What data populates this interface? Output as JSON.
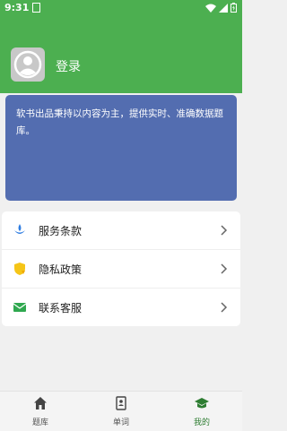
{
  "status_bar": {
    "time": "9:31",
    "sim_icon": "sim-card-icon",
    "wifi_icon": "wifi-icon",
    "signal_icon": "signal-icon",
    "battery_icon": "battery-charging-icon"
  },
  "header": {
    "login_label": "登录",
    "avatar_icon": "user-avatar-icon",
    "bg_color": "#4caf50"
  },
  "intro": {
    "text": "软书出品秉持以内容为主，提供实时、准确数据题库。",
    "bg_color": "#536db0"
  },
  "menu": {
    "items": [
      {
        "label": "服务条款",
        "icon": "drop-icon"
      },
      {
        "label": "隐私政策",
        "icon": "shield-icon"
      },
      {
        "label": "联系客服",
        "icon": "mail-icon"
      }
    ]
  },
  "tabs": [
    {
      "label": "题库",
      "icon": "home-icon",
      "active": false
    },
    {
      "label": "单词",
      "icon": "phone-book-icon",
      "active": false
    },
    {
      "label": "我的",
      "icon": "graduation-cap-icon",
      "active": true
    }
  ]
}
